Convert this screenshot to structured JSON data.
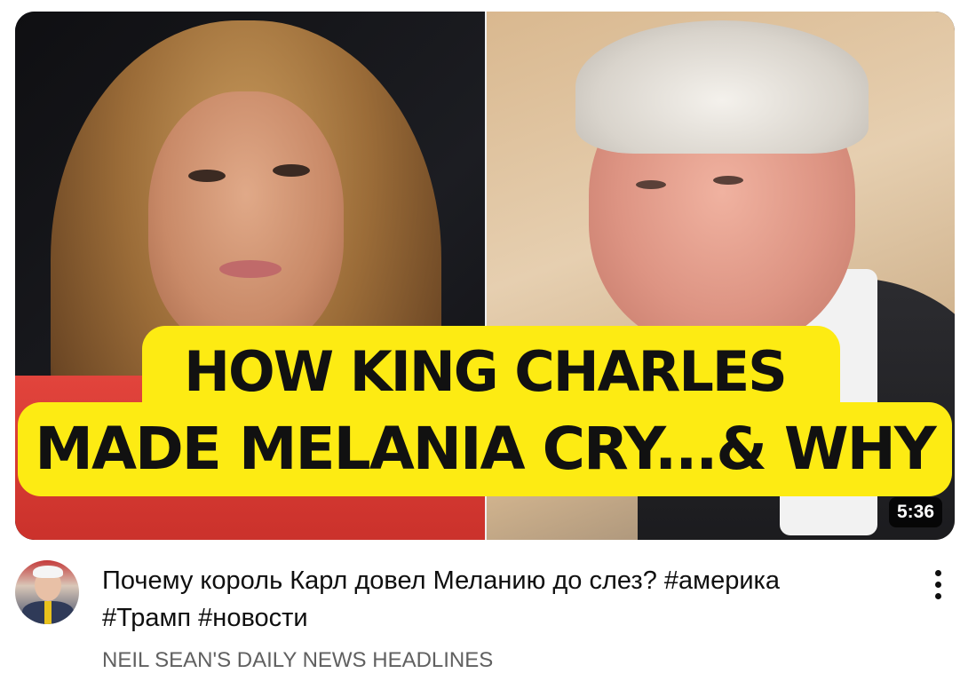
{
  "thumbnail": {
    "headline_line1": "HOW KING CHARLES",
    "headline_line2": "MADE MELANIA CRY...& WHY",
    "duration": "5:36",
    "banner_color": "#fdeb13"
  },
  "video": {
    "title_line1": "Почему король Карл довел Меланию до слез? #америка",
    "title_line2": "#Трамп #новости",
    "channel": "NEIL SEAN'S DAILY NEWS HEADLINES"
  },
  "icons": {
    "menu": "more-vert-icon"
  }
}
